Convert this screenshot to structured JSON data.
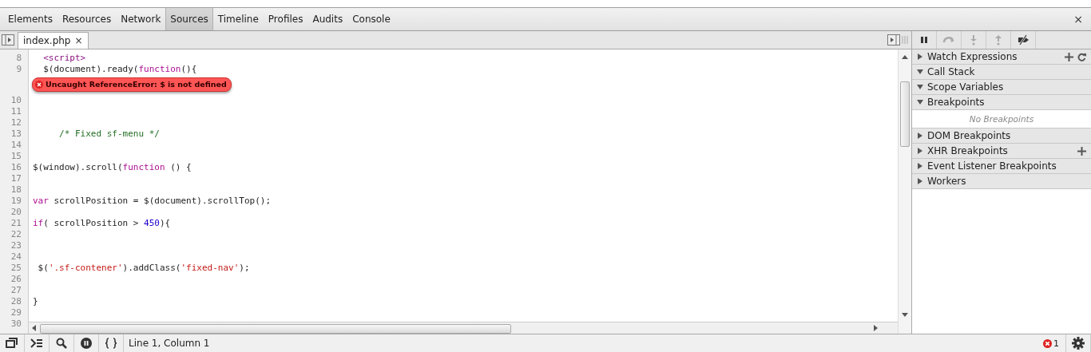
{
  "panel_tabs": [
    {
      "label": "Elements",
      "selected": false
    },
    {
      "label": "Resources",
      "selected": false
    },
    {
      "label": "Network",
      "selected": false
    },
    {
      "label": "Sources",
      "selected": true
    },
    {
      "label": "Timeline",
      "selected": false
    },
    {
      "label": "Profiles",
      "selected": false
    },
    {
      "label": "Audits",
      "selected": false
    },
    {
      "label": "Console",
      "selected": false
    }
  ],
  "close_glyph": "×",
  "file_tab": {
    "label": "index.php",
    "close_glyph": "×"
  },
  "code_rows": [
    {
      "kind": "code",
      "number": "8",
      "tokens": [
        {
          "kind": "tag",
          "text": "  <script>"
        }
      ]
    },
    {
      "kind": "code",
      "number": "9",
      "tokens": [
        {
          "kind": "plain",
          "text": "  $(document).ready("
        },
        {
          "kind": "keyword",
          "text": "function"
        },
        {
          "kind": "plain",
          "text": "(){"
        }
      ]
    },
    {
      "kind": "error",
      "text": "Uncaught ReferenceError: $ is not defined"
    },
    {
      "kind": "code",
      "number": "10",
      "tokens": []
    },
    {
      "kind": "code",
      "number": "11",
      "tokens": []
    },
    {
      "kind": "code",
      "number": "12",
      "tokens": []
    },
    {
      "kind": "code",
      "number": "13",
      "tokens": [
        {
          "kind": "comment",
          "text": "     /* Fixed sf-menu */"
        }
      ]
    },
    {
      "kind": "code",
      "number": "14",
      "tokens": []
    },
    {
      "kind": "code",
      "number": "15",
      "tokens": []
    },
    {
      "kind": "code",
      "number": "16",
      "tokens": [
        {
          "kind": "plain",
          "text": "$(window).scroll("
        },
        {
          "kind": "keyword",
          "text": "function"
        },
        {
          "kind": "plain",
          "text": " () {"
        }
      ]
    },
    {
      "kind": "code",
      "number": "17",
      "tokens": []
    },
    {
      "kind": "code",
      "number": "18",
      "tokens": []
    },
    {
      "kind": "code",
      "number": "19",
      "tokens": [
        {
          "kind": "keyword",
          "text": "var"
        },
        {
          "kind": "plain",
          "text": " scrollPosition = $(document).scrollTop();"
        }
      ]
    },
    {
      "kind": "code",
      "number": "20",
      "tokens": []
    },
    {
      "kind": "code",
      "number": "21",
      "tokens": [
        {
          "kind": "keyword",
          "text": "if"
        },
        {
          "kind": "plain",
          "text": "( scrollPosition > "
        },
        {
          "kind": "number",
          "text": "450"
        },
        {
          "kind": "plain",
          "text": "){"
        }
      ]
    },
    {
      "kind": "code",
      "number": "22",
      "tokens": []
    },
    {
      "kind": "code",
      "number": "23",
      "tokens": []
    },
    {
      "kind": "code",
      "number": "24",
      "tokens": []
    },
    {
      "kind": "code",
      "number": "25",
      "tokens": [
        {
          "kind": "plain",
          "text": " $("
        },
        {
          "kind": "string",
          "text": "'.sf-contener'"
        },
        {
          "kind": "plain",
          "text": ").addClass("
        },
        {
          "kind": "string",
          "text": "'fixed-nav'"
        },
        {
          "kind": "plain",
          "text": ");"
        }
      ]
    },
    {
      "kind": "code",
      "number": "26",
      "tokens": []
    },
    {
      "kind": "code",
      "number": "27",
      "tokens": []
    },
    {
      "kind": "code",
      "number": "28",
      "tokens": [
        {
          "kind": "plain",
          "text": "}"
        }
      ]
    },
    {
      "kind": "code",
      "number": "29",
      "tokens": []
    },
    {
      "kind": "code",
      "number": "30",
      "tokens": []
    }
  ],
  "debug_buttons": [
    {
      "kind": "pause",
      "disabled": false
    },
    {
      "kind": "step-over",
      "disabled": true
    },
    {
      "kind": "step-into",
      "disabled": true
    },
    {
      "kind": "step-out",
      "disabled": true
    },
    {
      "kind": "deactivate",
      "disabled": false
    }
  ],
  "sidebar_sections": [
    {
      "label": "Watch Expressions",
      "expanded": false,
      "add_button": true,
      "refresh_button": true
    },
    {
      "label": "Call Stack",
      "expanded": true
    },
    {
      "label": "Scope Variables",
      "expanded": true
    },
    {
      "label": "Breakpoints",
      "expanded": true,
      "empty_text": "No Breakpoints"
    },
    {
      "label": "DOM Breakpoints",
      "expanded": false
    },
    {
      "label": "XHR Breakpoints",
      "expanded": false,
      "add_button": true
    },
    {
      "label": "Event Listener Breakpoints",
      "expanded": false
    },
    {
      "label": "Workers",
      "expanded": false
    }
  ],
  "status_bar": {
    "position": "Line 1, Column 1",
    "error_count": "1"
  }
}
